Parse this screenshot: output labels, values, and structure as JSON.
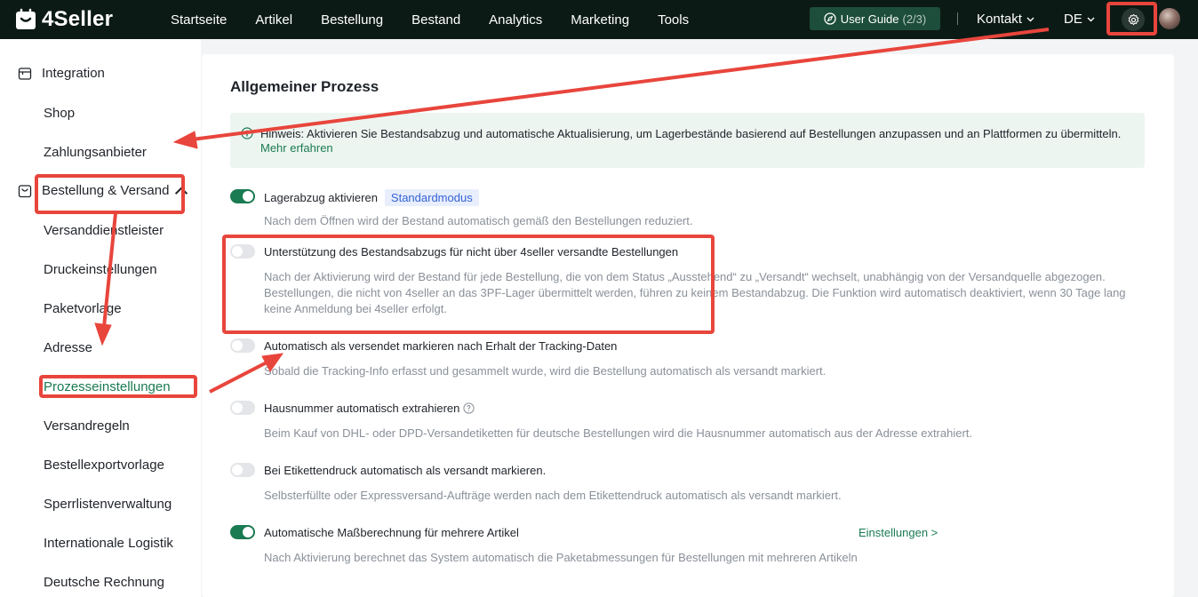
{
  "brand": {
    "name": "4Seller"
  },
  "nav": {
    "items": [
      "Startseite",
      "Artikel",
      "Bestellung",
      "Bestand",
      "Analytics",
      "Marketing",
      "Tools"
    ]
  },
  "header": {
    "guide_label": "User Guide",
    "guide_progress": "(2/3)",
    "contact_label": "Kontakt",
    "language": "DE",
    "settings_icon": "gear-icon"
  },
  "sidebar": {
    "integration": "Integration",
    "shop": "Shop",
    "payment": "Zahlungsanbieter",
    "order_shipping": "Bestellung & Versand",
    "items": [
      "Versanddienstleister",
      "Druckeinstellungen",
      "Paketvorlage",
      "Adresse",
      "Prozesseinstellungen",
      "Versandregeln",
      "Bestellexportvorlage",
      "Sperrlistenverwaltung",
      "Internationale Logistik",
      "Deutsche Rechnung"
    ],
    "active_item": "Prozesseinstellungen"
  },
  "main": {
    "title": "Allgemeiner Prozess",
    "notice": {
      "text": "Hinweis: Aktivieren Sie Bestandsabzug und automatische Aktualisierung, um Lagerbestände basierend auf Bestellungen anzupassen und an Plattformen zu übermitteln.",
      "link": "Mehr erfahren"
    },
    "settings": [
      {
        "title": "Lagerabzug aktivieren",
        "tag": "Standardmodus",
        "enabled": true,
        "desc": "Nach dem Öffnen wird der Bestand automatisch gemäß den Bestellungen reduziert."
      },
      {
        "title": "Unterstützung des Bestandsabzugs für nicht über 4seller versandte Bestellungen",
        "enabled": false,
        "desc": "Nach der Aktivierung wird der Bestand für jede Bestellung, die von dem Status „Ausstehend“ zu „Versandt“ wechselt, unabhängig von der Versandquelle abgezogen. Bestellungen, die nicht von 4seller an das 3PF-Lager übermittelt werden, führen zu keinem Bestandabzug. Die Funktion wird automatisch deaktiviert, wenn 30 Tage lang keine Anmeldung bei 4seller erfolgt."
      },
      {
        "title": "Automatisch als versendet markieren nach Erhalt der Tracking-Daten",
        "enabled": false,
        "desc": "Sobald die Tracking-Info erfasst und gesammelt wurde, wird die Bestellung automatisch als versandt markiert."
      },
      {
        "title": "Hausnummer automatisch extrahieren",
        "enabled": false,
        "help_icon": "question-circle-icon",
        "desc": "Beim Kauf von DHL- oder DPD-Versandetiketten für deutsche Bestellungen wird die Hausnummer automatisch aus der Adresse extrahiert."
      },
      {
        "title": "Bei Etikettendruck automatisch als versandt markieren.",
        "enabled": false,
        "desc": "Selbsterfüllte oder Expressversand-Aufträge werden nach dem Etikettendruck automatisch als versandt markiert."
      },
      {
        "title": "Automatische Maßberechnung für mehrere Artikel",
        "enabled": true,
        "link": "Einstellungen >",
        "desc": "Nach Aktivierung berechnet das System automatisch die Paketabmessungen für Bestellungen mit mehreren Artikeln"
      }
    ]
  },
  "colors": {
    "topbar": "#0c1a15",
    "accent": "#1a7a52",
    "annotation": "#e8453c",
    "tag_bg": "#e8eefc",
    "tag_text": "#3463d6"
  }
}
